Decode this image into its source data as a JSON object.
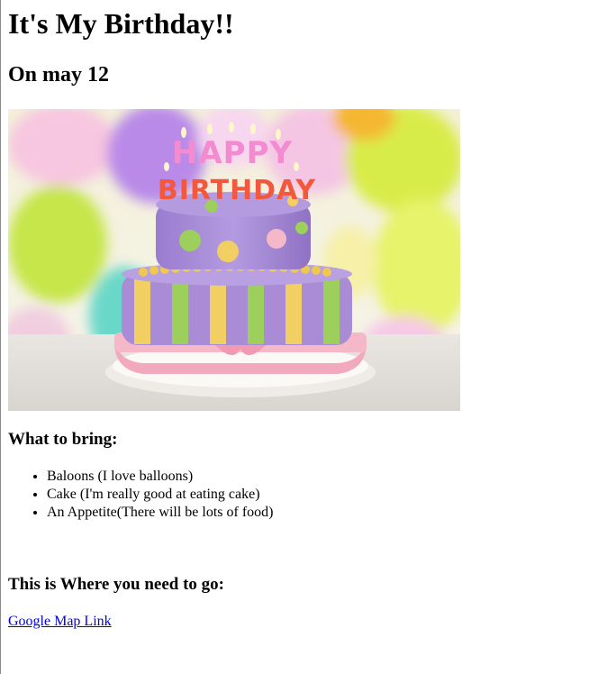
{
  "page": {
    "title": "It's My Birthday!!",
    "date": "On may 12"
  },
  "image": {
    "topper_text": "HAPPY BIRTHDAY",
    "colors": {
      "cake_purple": "#a98bd6",
      "cake_yellow": "#f2cf62",
      "cake_green": "#9ccf5b",
      "ribbon_pink": "#f4b8c8",
      "plate": "#f4f1ec"
    }
  },
  "bring": {
    "heading": "What to bring:",
    "items": [
      "Baloons (I love balloons)",
      "Cake (I'm really good at eating cake)",
      "An Appetite(There will be lots of food)"
    ]
  },
  "where": {
    "heading": "This is Where you need to go:",
    "link_label": "Google Map Link"
  }
}
